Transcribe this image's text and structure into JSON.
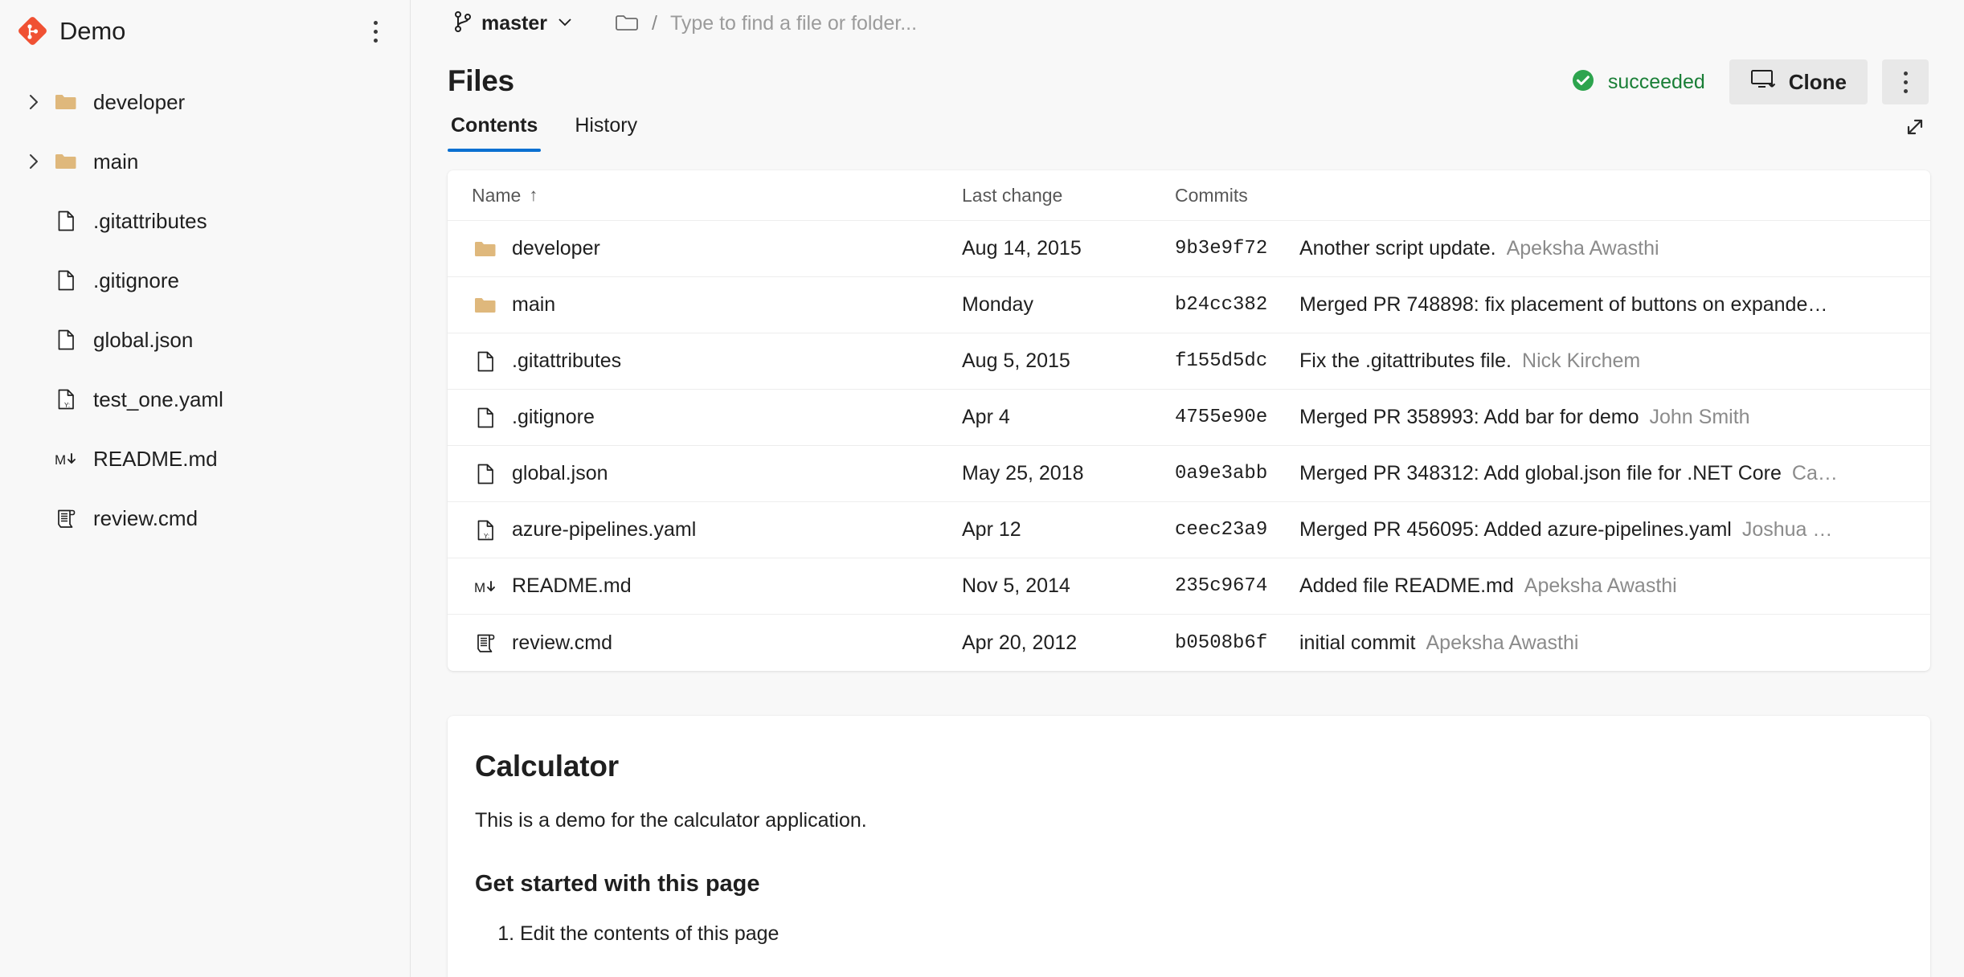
{
  "sidebar": {
    "repo_name": "Demo",
    "logo_icon": "git-repo-icon",
    "overflow_icon": "kebab-menu-icon",
    "tree": [
      {
        "label": "developer",
        "type": "folder",
        "icon": "folder-icon",
        "expandable": true
      },
      {
        "label": "main",
        "type": "folder",
        "icon": "folder-icon",
        "expandable": true
      },
      {
        "label": ".gitattributes",
        "type": "file",
        "icon": "file-icon",
        "expandable": false
      },
      {
        "label": ".gitignore",
        "type": "file",
        "icon": "file-icon",
        "expandable": false
      },
      {
        "label": "global.json",
        "type": "file",
        "icon": "file-icon",
        "expandable": false
      },
      {
        "label": "test_one.yaml",
        "type": "file",
        "icon": "yaml-file-icon",
        "expandable": false
      },
      {
        "label": "README.md",
        "type": "file",
        "icon": "markdown-icon",
        "expandable": false
      },
      {
        "label": "review.cmd",
        "type": "file",
        "icon": "script-icon",
        "expandable": false
      }
    ]
  },
  "topbar": {
    "branch_icon": "branch-icon",
    "branch_name": "master",
    "branch_chevron_icon": "chevron-down-icon",
    "folder_icon": "folder-outline-icon",
    "separator": "/",
    "search_placeholder": "Type to find a file or folder...",
    "search_value": ""
  },
  "header": {
    "title": "Files",
    "status_label": "succeeded",
    "status_icon": "check-circle-icon",
    "status_color": "#1a7f37",
    "clone_label": "Clone",
    "clone_icon": "clone-monitor-icon",
    "more_icon": "kebab-menu-icon"
  },
  "tabs": {
    "items": [
      {
        "label": "Contents",
        "active": true
      },
      {
        "label": "History",
        "active": false
      }
    ],
    "expand_icon": "expand-diagonal-icon",
    "accent_color": "#0a70d1"
  },
  "files_table": {
    "columns": [
      "Name",
      "Last change",
      "Commits",
      ""
    ],
    "sort_column": "Name",
    "sort_icon": "arrow-up-icon",
    "rows": [
      {
        "name": "developer",
        "icon": "folder-icon",
        "last_change": "Aug 14, 2015",
        "commit": "9b3e9f72",
        "message": "Another script update.",
        "author": "Apeksha Awasthi"
      },
      {
        "name": "main",
        "icon": "folder-icon",
        "last_change": "Monday",
        "commit": "b24cc382",
        "message": "Merged PR 748898: fix placement of buttons on expande…",
        "author": ""
      },
      {
        "name": ".gitattributes",
        "icon": "file-icon",
        "last_change": "Aug 5, 2015",
        "commit": "f155d5dc",
        "message": "Fix the .gitattributes file.",
        "author": "Nick Kirchem"
      },
      {
        "name": ".gitignore",
        "icon": "file-icon",
        "last_change": "Apr 4",
        "commit": "4755e90e",
        "message": "Merged PR 358993: Add bar for demo",
        "author": "John Smith"
      },
      {
        "name": "global.json",
        "icon": "file-icon",
        "last_change": "May 25, 2018",
        "commit": "0a9e3abb",
        "message": "Merged PR 348312: Add global.json file for .NET Core",
        "author": "Ca…"
      },
      {
        "name": "azure-pipelines.yaml",
        "icon": "yaml-file-icon",
        "last_change": "Apr 12",
        "commit": "ceec23a9",
        "message": "Merged PR 456095: Added azure-pipelines.yaml",
        "author": "Joshua …"
      },
      {
        "name": "README.md",
        "icon": "markdown-icon",
        "last_change": "Nov 5, 2014",
        "commit": "235c9674",
        "message": "Added file README.md",
        "author": "Apeksha Awasthi"
      },
      {
        "name": "review.cmd",
        "icon": "script-icon",
        "last_change": "Apr 20, 2012",
        "commit": "b0508b6f",
        "message": "initial commit",
        "author": "Apeksha Awasthi"
      }
    ]
  },
  "readme": {
    "title": "Calculator",
    "intro": "This is a demo for the calculator application.",
    "section_heading": "Get started with this page",
    "steps": [
      "Edit the contents of this page"
    ]
  }
}
